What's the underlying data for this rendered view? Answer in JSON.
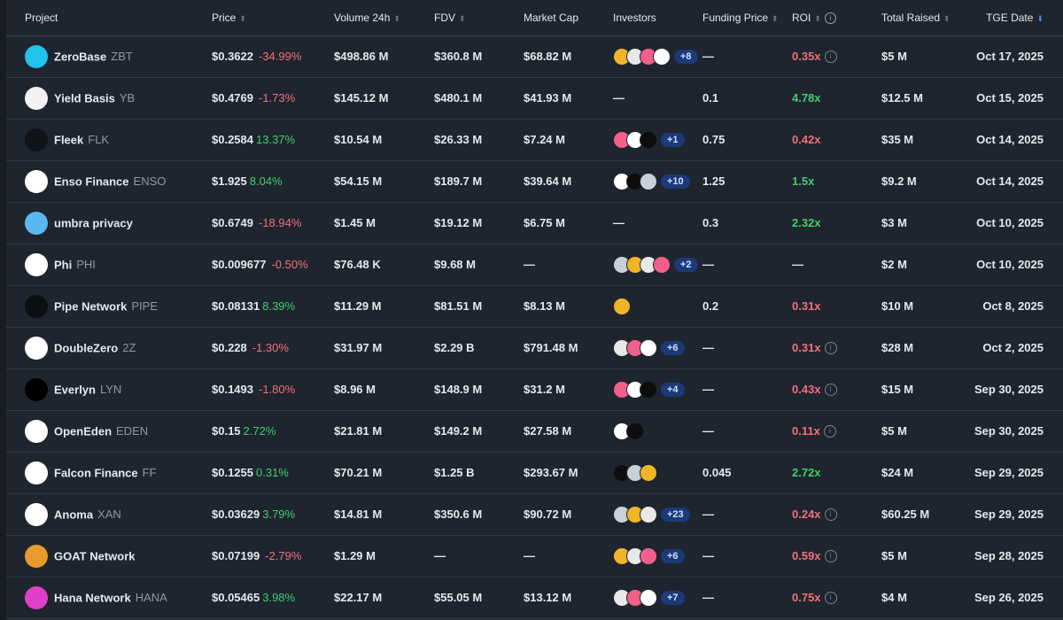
{
  "headers": {
    "project": "Project",
    "price": "Price",
    "volume": "Volume 24h",
    "fdv": "FDV",
    "market_cap": "Market Cap",
    "investors": "Investors",
    "funding_price": "Funding Price",
    "roi": "ROI",
    "total_raised": "Total Raised",
    "tge_date": "TGE Date"
  },
  "rows": [
    {
      "name": "ZeroBase",
      "symbol": "ZBT",
      "price": "$0.3622",
      "change": "-34.99%",
      "dir": "neg",
      "volume": "$498.86 M",
      "fdv": "$360.8 M",
      "mcap": "$68.82 M",
      "investor_count": 4,
      "more": "+8",
      "funding": "—",
      "roi": "0.35x",
      "roi_dir": "neg",
      "roi_info": true,
      "raised": "$5 M",
      "date": "Oct 17, 2025",
      "logo_color": "#20c4e8"
    },
    {
      "name": "Yield Basis",
      "symbol": "YB",
      "price": "$0.4769",
      "change": "-1.73%",
      "dir": "neg",
      "volume": "$145.12 M",
      "fdv": "$480.1 M",
      "mcap": "$41.93 M",
      "investor_count": 0,
      "more": "",
      "funding": "0.1",
      "roi": "4.78x",
      "roi_dir": "pos",
      "roi_info": false,
      "raised": "$12.5 M",
      "date": "Oct 15, 2025",
      "logo_color": "#f2f2f2"
    },
    {
      "name": "Fleek",
      "symbol": "FLK",
      "price": "$0.2584",
      "change": "13.37%",
      "dir": "pos",
      "volume": "$10.54 M",
      "fdv": "$26.33 M",
      "mcap": "$7.24 M",
      "investor_count": 3,
      "more": "+1",
      "funding": "0.75",
      "roi": "0.42x",
      "roi_dir": "neg",
      "roi_info": false,
      "raised": "$35 M",
      "date": "Oct 14, 2025",
      "logo_color": "#111318"
    },
    {
      "name": "Enso Finance",
      "symbol": "ENSO",
      "price": "$1.925",
      "change": "8.04%",
      "dir": "pos",
      "volume": "$54.15 M",
      "fdv": "$189.7 M",
      "mcap": "$39.64 M",
      "investor_count": 3,
      "more": "+10",
      "funding": "1.25",
      "roi": "1.5x",
      "roi_dir": "pos",
      "roi_info": false,
      "raised": "$9.2 M",
      "date": "Oct 14, 2025",
      "logo_color": "#ffffff"
    },
    {
      "name": "umbra privacy",
      "symbol": "",
      "price": "$0.6749",
      "change": "-18.94%",
      "dir": "neg",
      "volume": "$1.45 M",
      "fdv": "$19.12 M",
      "mcap": "$6.75 M",
      "investor_count": 0,
      "more": "",
      "funding": "0.3",
      "roi": "2.32x",
      "roi_dir": "pos",
      "roi_info": false,
      "raised": "$3 M",
      "date": "Oct 10, 2025",
      "logo_color": "#5ab8f0"
    },
    {
      "name": "Phi",
      "symbol": "PHI",
      "price": "$0.009677",
      "change": "-0.50%",
      "dir": "neg",
      "volume": "$76.48 K",
      "fdv": "$9.68 M",
      "mcap": "—",
      "investor_count": 4,
      "more": "+2",
      "funding": "—",
      "roi": "—",
      "roi_dir": "none",
      "roi_info": false,
      "raised": "$2 M",
      "date": "Oct 10, 2025",
      "logo_color": "#ffffff"
    },
    {
      "name": "Pipe Network",
      "symbol": "PIPE",
      "price": "$0.08131",
      "change": "8.39%",
      "dir": "pos",
      "volume": "$11.29 M",
      "fdv": "$81.51 M",
      "mcap": "$8.13 M",
      "investor_count": 1,
      "more": "",
      "funding": "0.2",
      "roi": "0.31x",
      "roi_dir": "neg",
      "roi_info": false,
      "raised": "$10 M",
      "date": "Oct 8, 2025",
      "logo_color": "#0c0f12"
    },
    {
      "name": "DoubleZero",
      "symbol": "2Z",
      "price": "$0.228",
      "change": "-1.30%",
      "dir": "neg",
      "volume": "$31.97 M",
      "fdv": "$2.29 B",
      "mcap": "$791.48 M",
      "investor_count": 3,
      "more": "+6",
      "funding": "—",
      "roi": "0.31x",
      "roi_dir": "neg",
      "roi_info": true,
      "raised": "$28 M",
      "date": "Oct 2, 2025",
      "logo_color": "#ffffff"
    },
    {
      "name": "Everlyn",
      "symbol": "LYN",
      "price": "$0.1493",
      "change": "-1.80%",
      "dir": "neg",
      "volume": "$8.96 M",
      "fdv": "$148.9 M",
      "mcap": "$31.2 M",
      "investor_count": 3,
      "more": "+4",
      "funding": "—",
      "roi": "0.43x",
      "roi_dir": "neg",
      "roi_info": true,
      "raised": "$15 M",
      "date": "Sep 30, 2025",
      "logo_color": "#000000"
    },
    {
      "name": "OpenEden",
      "symbol": "EDEN",
      "price": "$0.15",
      "change": "2.72%",
      "dir": "pos",
      "volume": "$21.81 M",
      "fdv": "$149.2 M",
      "mcap": "$27.58 M",
      "investor_count": 2,
      "more": "",
      "funding": "—",
      "roi": "0.11x",
      "roi_dir": "neg",
      "roi_info": true,
      "raised": "$5 M",
      "date": "Sep 30, 2025",
      "logo_color": "#ffffff"
    },
    {
      "name": "Falcon Finance",
      "symbol": "FF",
      "price": "$0.1255",
      "change": "0.31%",
      "dir": "pos",
      "volume": "$70.21 M",
      "fdv": "$1.25 B",
      "mcap": "$293.67 M",
      "investor_count": 3,
      "more": "",
      "funding": "0.045",
      "roi": "2.72x",
      "roi_dir": "pos",
      "roi_info": false,
      "raised": "$24 M",
      "date": "Sep 29, 2025",
      "logo_color": "#ffffff"
    },
    {
      "name": "Anoma",
      "symbol": "XAN",
      "price": "$0.03629",
      "change": "3.79%",
      "dir": "pos",
      "volume": "$14.81 M",
      "fdv": "$350.6 M",
      "mcap": "$90.72 M",
      "investor_count": 3,
      "more": "+23",
      "funding": "—",
      "roi": "0.24x",
      "roi_dir": "neg",
      "roi_info": true,
      "raised": "$60.25 M",
      "date": "Sep 29, 2025",
      "logo_color": "#ffffff"
    },
    {
      "name": "GOAT Network",
      "symbol": "",
      "price": "$0.07199",
      "change": "-2.79%",
      "dir": "neg",
      "volume": "$1.29 M",
      "fdv": "—",
      "mcap": "—",
      "investor_count": 3,
      "more": "+6",
      "funding": "—",
      "roi": "0.59x",
      "roi_dir": "neg",
      "roi_info": true,
      "raised": "$5 M",
      "date": "Sep 28, 2025",
      "logo_color": "#e89a2c"
    },
    {
      "name": "Hana Network",
      "symbol": "HANA",
      "price": "$0.05465",
      "change": "3.98%",
      "dir": "pos",
      "volume": "$22.17 M",
      "fdv": "$55.05 M",
      "mcap": "$13.12 M",
      "investor_count": 3,
      "more": "+7",
      "funding": "—",
      "roi": "0.75x",
      "roi_dir": "neg",
      "roi_info": true,
      "raised": "$4 M",
      "date": "Sep 26, 2025",
      "logo_color": "#e040c8"
    }
  ],
  "colors": {
    "background": "#1f252e",
    "positive": "#3ecf6f",
    "negative": "#f07178",
    "badge": "#1c3a78",
    "sort_active": "#4a8cf5"
  },
  "icons": {
    "sort": "sort-arrows-icon",
    "sort_active": "sort-desc-icon",
    "info": "info-circle-icon"
  }
}
